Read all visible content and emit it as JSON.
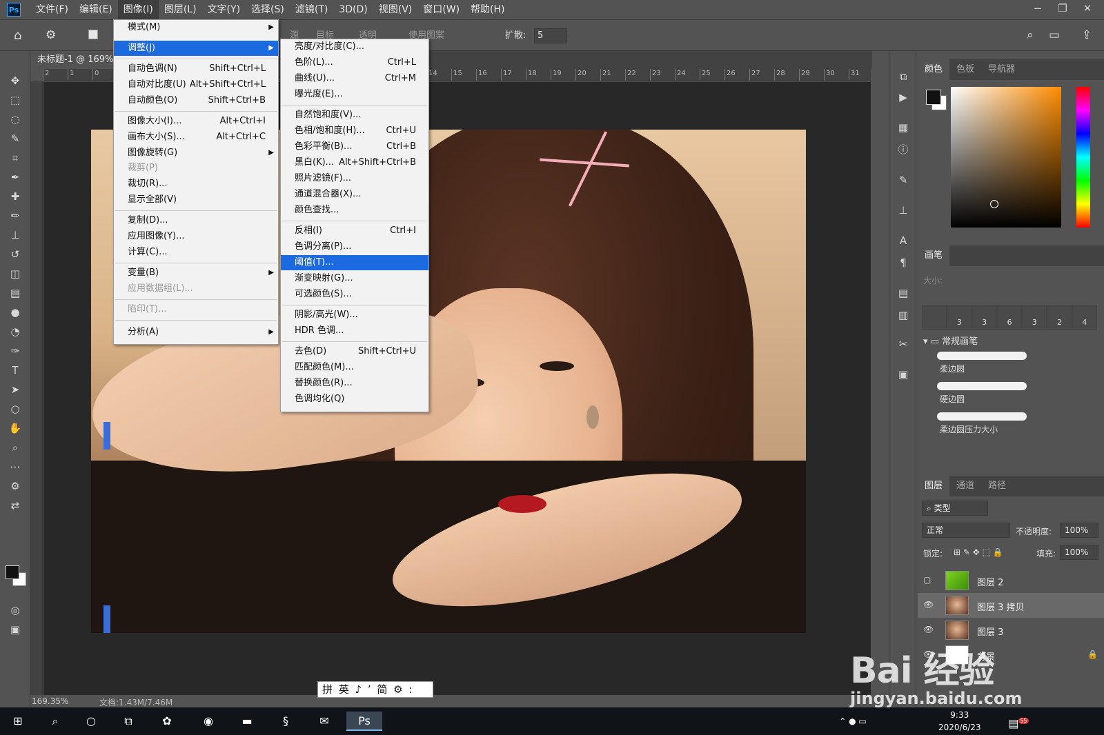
{
  "menubar": {
    "items": [
      "文件(F)",
      "编辑(E)",
      "图像(I)",
      "图层(L)",
      "文字(Y)",
      "选择(S)",
      "滤镜(T)",
      "3D(D)",
      "视图(V)",
      "窗口(W)",
      "帮助(H)"
    ],
    "logo": "Ps"
  },
  "optionsbar": {
    "frag1": "源",
    "frag2": "目标",
    "frag3": "透明",
    "frag4": "使用图案",
    "spread_label": "扩散:",
    "spread_value": "5"
  },
  "document": {
    "tab_title": "未标题-1 @ 169%",
    "zoom": "169.35%",
    "doc_info": "文档:1.43M/7.46M",
    "ruler_labels": [
      "2",
      "1",
      "0",
      "1",
      "14",
      "15",
      "16",
      "17",
      "18",
      "19",
      "20",
      "21",
      "22",
      "23",
      "24",
      "25",
      "26",
      "27",
      "28",
      "29",
      "30",
      "31"
    ]
  },
  "image_menu": {
    "items": [
      {
        "label": "模式(M)",
        "shortcut": "",
        "submenu": true
      },
      {
        "label": "调整(J)",
        "shortcut": "",
        "submenu": true,
        "highlight": true
      },
      {
        "label": "自动色调(N)",
        "shortcut": "Shift+Ctrl+L"
      },
      {
        "label": "自动对比度(U)",
        "shortcut": "Alt+Shift+Ctrl+L"
      },
      {
        "label": "自动颜色(O)",
        "shortcut": "Shift+Ctrl+B"
      },
      {
        "label": "图像大小(I)...",
        "shortcut": "Alt+Ctrl+I"
      },
      {
        "label": "画布大小(S)...",
        "shortcut": "Alt+Ctrl+C"
      },
      {
        "label": "图像旋转(G)",
        "shortcut": "",
        "submenu": true
      },
      {
        "label": "裁剪(P)",
        "shortcut": "",
        "disabled": true
      },
      {
        "label": "裁切(R)...",
        "shortcut": ""
      },
      {
        "label": "显示全部(V)",
        "shortcut": ""
      },
      {
        "label": "复制(D)...",
        "shortcut": ""
      },
      {
        "label": "应用图像(Y)...",
        "shortcut": ""
      },
      {
        "label": "计算(C)...",
        "shortcut": ""
      },
      {
        "label": "变量(B)",
        "shortcut": "",
        "submenu": true
      },
      {
        "label": "应用数据组(L)...",
        "shortcut": "",
        "disabled": true
      },
      {
        "label": "陷印(T)...",
        "shortcut": "",
        "disabled": true
      },
      {
        "label": "分析(A)",
        "shortcut": "",
        "submenu": true
      }
    ]
  },
  "adjust_menu": {
    "items": [
      {
        "label": "亮度/对比度(C)...",
        "shortcut": ""
      },
      {
        "label": "色阶(L)...",
        "shortcut": "Ctrl+L"
      },
      {
        "label": "曲线(U)...",
        "shortcut": "Ctrl+M"
      },
      {
        "label": "曝光度(E)...",
        "shortcut": ""
      },
      {
        "label": "自然饱和度(V)...",
        "shortcut": ""
      },
      {
        "label": "色相/饱和度(H)...",
        "shortcut": "Ctrl+U"
      },
      {
        "label": "色彩平衡(B)...",
        "shortcut": "Ctrl+B"
      },
      {
        "label": "黑白(K)...",
        "shortcut": "Alt+Shift+Ctrl+B"
      },
      {
        "label": "照片滤镜(F)...",
        "shortcut": ""
      },
      {
        "label": "通道混合器(X)...",
        "shortcut": ""
      },
      {
        "label": "颜色查找...",
        "shortcut": ""
      },
      {
        "label": "反相(I)",
        "shortcut": "Ctrl+I"
      },
      {
        "label": "色调分离(P)...",
        "shortcut": ""
      },
      {
        "label": "阈值(T)...",
        "shortcut": "",
        "highlight": true
      },
      {
        "label": "渐变映射(G)...",
        "shortcut": ""
      },
      {
        "label": "可选颜色(S)...",
        "shortcut": ""
      },
      {
        "label": "阴影/高光(W)...",
        "shortcut": ""
      },
      {
        "label": "HDR 色调...",
        "shortcut": ""
      },
      {
        "label": "去色(D)",
        "shortcut": "Shift+Ctrl+U"
      },
      {
        "label": "匹配颜色(M)...",
        "shortcut": ""
      },
      {
        "label": "替换颜色(R)...",
        "shortcut": ""
      },
      {
        "label": "色调均化(Q)",
        "shortcut": ""
      }
    ]
  },
  "color_panel": {
    "tabs": [
      "颜色",
      "色板",
      "导航器"
    ],
    "hue_color": "#ff8c00"
  },
  "brush_panel": {
    "title": "画笔",
    "size_label": "大小:",
    "preset_sizes": [
      "",
      "3",
      "3",
      "6",
      "3",
      "2",
      "4"
    ],
    "group_name": "常规画笔",
    "brushes": [
      "柔边圆",
      "硬边圆",
      "柔边圆压力大小"
    ]
  },
  "layers_panel": {
    "tabs": [
      "图层",
      "通道",
      "路径"
    ],
    "filter": "类型",
    "blend_mode": "正常",
    "opacity_label": "不透明度:",
    "opacity_value": "100%",
    "lock_label": "锁定:",
    "fill_label": "填充:",
    "fill_value": "100%",
    "layers": [
      {
        "name": "图层 2",
        "visible": false
      },
      {
        "name": "图层 3 拷贝",
        "visible": true,
        "selected": true
      },
      {
        "name": "图层 3",
        "visible": true
      },
      {
        "name": "背景",
        "visible": true,
        "locked": true
      }
    ]
  },
  "ime_bar": "拼 英 ♪ ’ 简 ⚙ :",
  "taskbar": {
    "time": "9:33",
    "date": "2020/6/23",
    "notif_count": "55"
  },
  "watermark": {
    "big": "Bai 经验",
    "small": "jingyan.baidu.com"
  }
}
